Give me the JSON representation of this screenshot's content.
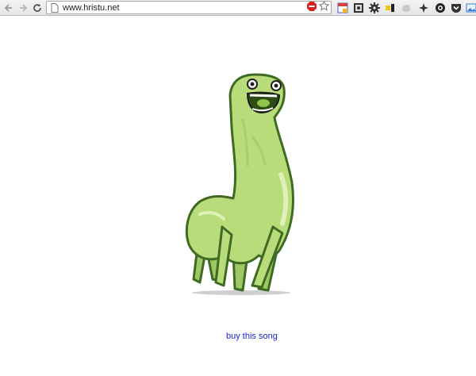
{
  "browser": {
    "url": "www.hristu.net",
    "icons": [
      "back-arrow-icon",
      "forward-arrow-icon",
      "reload-icon",
      "page-icon",
      "adblock-icon",
      "star-icon"
    ],
    "extensions": [
      "calendar-icon",
      "screenshot-icon",
      "gear-icon",
      "key-icon",
      "cloud-icon",
      "puzzle-icon",
      "circle-target-icon",
      "pocket-icon",
      "image-icon"
    ]
  },
  "page": {
    "link_text": "buy this song",
    "link_color": "#2222cc",
    "mascot_color": "#b9dc7a",
    "mascot_outline": "#3e6a22"
  }
}
